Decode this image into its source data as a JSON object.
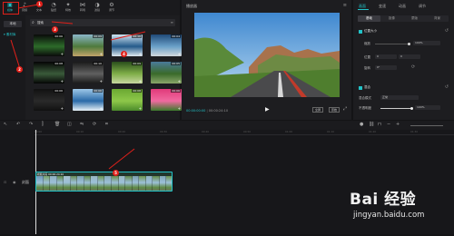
{
  "toolbar": {
    "items": [
      {
        "label": "媒体",
        "icon": "media-icon"
      },
      {
        "label": "音频",
        "icon": "audio-icon"
      },
      {
        "label": "文本",
        "icon": "text-icon"
      },
      {
        "label": "贴纸",
        "icon": "sticker-icon"
      },
      {
        "label": "特效",
        "icon": "effects-icon"
      },
      {
        "label": "转场",
        "icon": "transition-icon"
      },
      {
        "label": "滤镜",
        "icon": "filter-icon"
      },
      {
        "label": "调节",
        "icon": "adjust-icon"
      }
    ]
  },
  "sidebar": {
    "local": "本地",
    "library": "素材库"
  },
  "search": {
    "placeholder": "搜索"
  },
  "media": {
    "items": [
      {
        "duration": "00:06",
        "colors": [
          "#0a0a0a",
          "#2d6b2a",
          "#0a0a0a"
        ]
      },
      {
        "duration": "00:09",
        "colors": [
          "#8bb7c9",
          "#4e7a3c",
          "#c2a46a"
        ]
      },
      {
        "duration": "00:10",
        "colors": [
          "#cfe4f2",
          "#245a8a",
          "#dfe9ef"
        ]
      },
      {
        "duration": "00:04",
        "colors": [
          "#1f4a78",
          "#6aa0c8",
          "#d2d8dc"
        ]
      },
      {
        "duration": "00:08",
        "colors": [
          "#050505",
          "#3a5a3a",
          "#050505"
        ]
      },
      {
        "duration": "00:10",
        "colors": [
          "#1a1a1a",
          "#606060",
          "#1a1a1a"
        ]
      },
      {
        "duration": "00:09",
        "colors": [
          "#2a4e1c",
          "#7fae48",
          "#c7d7a0"
        ]
      },
      {
        "duration": "00:05",
        "colors": [
          "#4a7a9a",
          "#3a6a2a",
          "#8aa66a"
        ]
      },
      {
        "duration": "00:06",
        "colors": [
          "#111111",
          "#2a2a2a",
          "#111111"
        ]
      },
      {
        "duration": "00:06",
        "colors": [
          "#9ec8e8",
          "#2a6aa8",
          "#e8f2f8"
        ]
      },
      {
        "duration": "00:08",
        "colors": [
          "#6aa832",
          "#8ec84a",
          "#4a8a2a"
        ]
      },
      {
        "duration": "00:06",
        "colors": [
          "#e03a7a",
          "#f06aa0",
          "#3a7a2a"
        ]
      }
    ]
  },
  "player": {
    "title": "播放器",
    "time_current": "00:00:00:00",
    "time_total": "00:00:24:10",
    "btn_full": "全屏",
    "btn_ratio": "原始"
  },
  "inspector": {
    "tabs": [
      "画面",
      "变速",
      "动画",
      "调节"
    ],
    "segments": [
      "基础",
      "抠像",
      "蒙版",
      "背景"
    ],
    "section_transform": "位置大小",
    "scale_label": "缩放",
    "scale_value": "100%",
    "position_label": "位置",
    "pos_x": "0",
    "pos_y": "0",
    "rotate_label": "旋转",
    "rotate_value": "0°",
    "section_blend": "混合",
    "blend_mode_label": "混合模式",
    "blend_mode_value": "正常",
    "opacity_label": "不透明度",
    "opacity_value": "100%"
  },
  "timeline": {
    "cover_label": "封面",
    "ruler_ticks": [
      "00:00",
      "00:10",
      "00:20",
      "00:30",
      "00:40",
      "00:50",
      "01:00",
      "01:10",
      "01:20",
      "01:30"
    ],
    "clip_label": "视频片段  00:00:24:10",
    "clip_frames": [
      "#6e98b8",
      "#79a36a",
      "#8fb0c0",
      "#5f8a4a",
      "#a7c0cc",
      "#6b8f58",
      "#7aa0b0",
      "#5d8646",
      "#98b6c2",
      "#6c9552",
      "#86a8b8",
      "#6a8f4c",
      "#9ab8c4",
      "#62894c",
      "#7c9eae",
      "#6f9550",
      "#90b2c0",
      "#658c4a",
      "#82a6b6",
      "#6d9350"
    ]
  },
  "badges": [
    "1",
    "2",
    "3",
    "4",
    "5"
  ],
  "watermark": {
    "site": "jingyan.baidu.com",
    "brand": "Bai 经验"
  }
}
